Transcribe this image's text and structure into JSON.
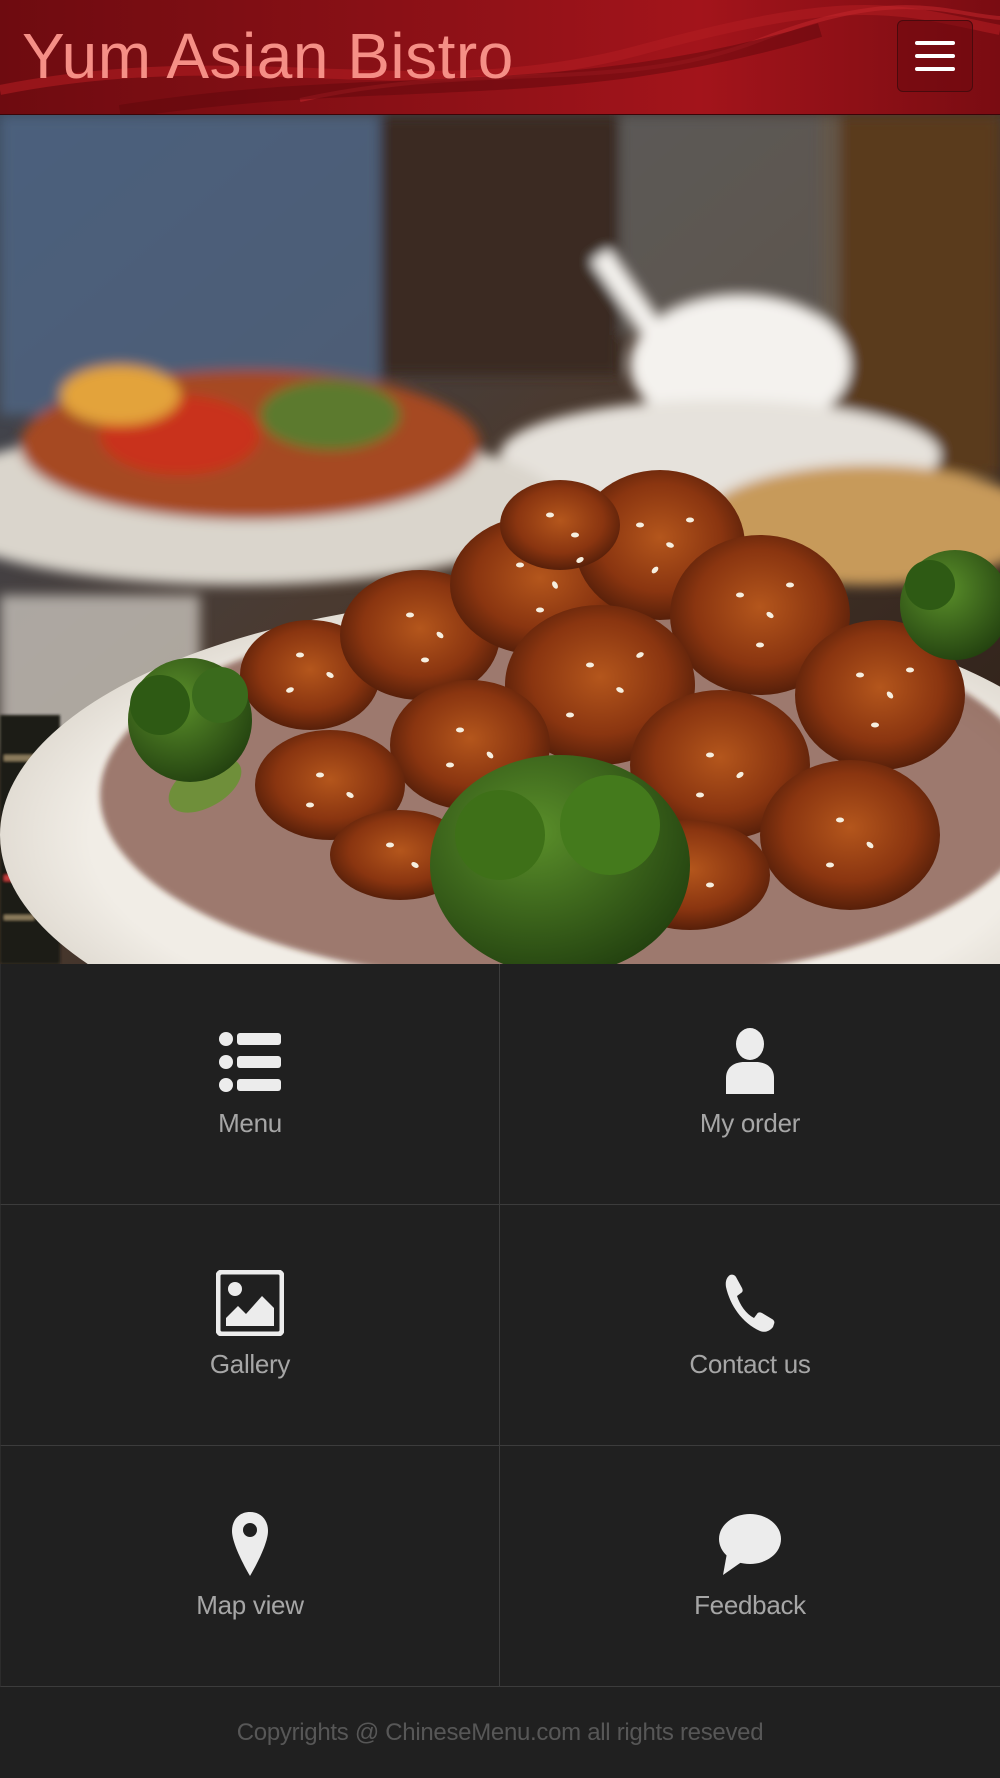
{
  "header": {
    "title": "Yum Asian Bistro",
    "menu_icon": "hamburger-menu-icon"
  },
  "hero": {
    "image_description": ""
  },
  "tiles": [
    {
      "label": "Menu",
      "icon": "list-icon"
    },
    {
      "label": "My order",
      "icon": "user-icon"
    },
    {
      "label": "Gallery",
      "icon": "image-icon"
    },
    {
      "label": "Contact us",
      "icon": "phone-icon"
    },
    {
      "label": "Map view",
      "icon": "map-pin-icon"
    },
    {
      "label": "Feedback",
      "icon": "chat-bubble-icon"
    }
  ],
  "footer": {
    "copyright": "Copyrights @ ChineseMenu.com all rights reseved"
  },
  "colors": {
    "header_red": "#8e1117",
    "title_pink": "#f58f86",
    "tile_bg": "#202020",
    "tile_label": "#a6a6a6",
    "icon_white": "#ececec"
  }
}
